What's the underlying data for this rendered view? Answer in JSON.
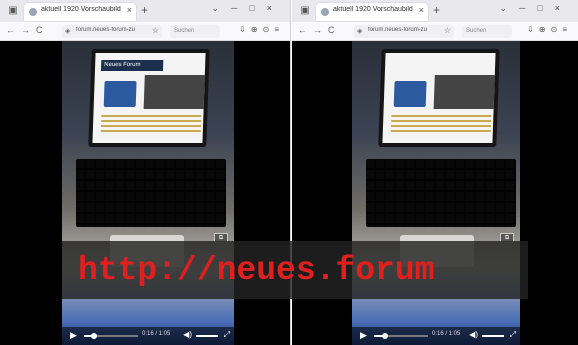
{
  "windows": [
    {
      "tab_title": "aktuell 1920 Vorschaubilder",
      "url": "forum.neues-forum-zu",
      "search_placeholder": "Suchen",
      "video_screen_header": "Neues Forum",
      "video_time": "0:16 / 1:05",
      "video_progress": 0.18
    },
    {
      "tab_title": "aktuell 1920 Vorschaubilder",
      "url": "forum.neues-forum-zu",
      "search_placeholder": "Suchen",
      "video_screen_header": "",
      "video_time": "0:16 / 1:05",
      "video_progress": 0.2
    }
  ],
  "overlay": {
    "watermark_text": "http://neues.forum"
  },
  "colors": {
    "watermark": "#e0201f",
    "tab_bar": "#e9e9ed"
  }
}
